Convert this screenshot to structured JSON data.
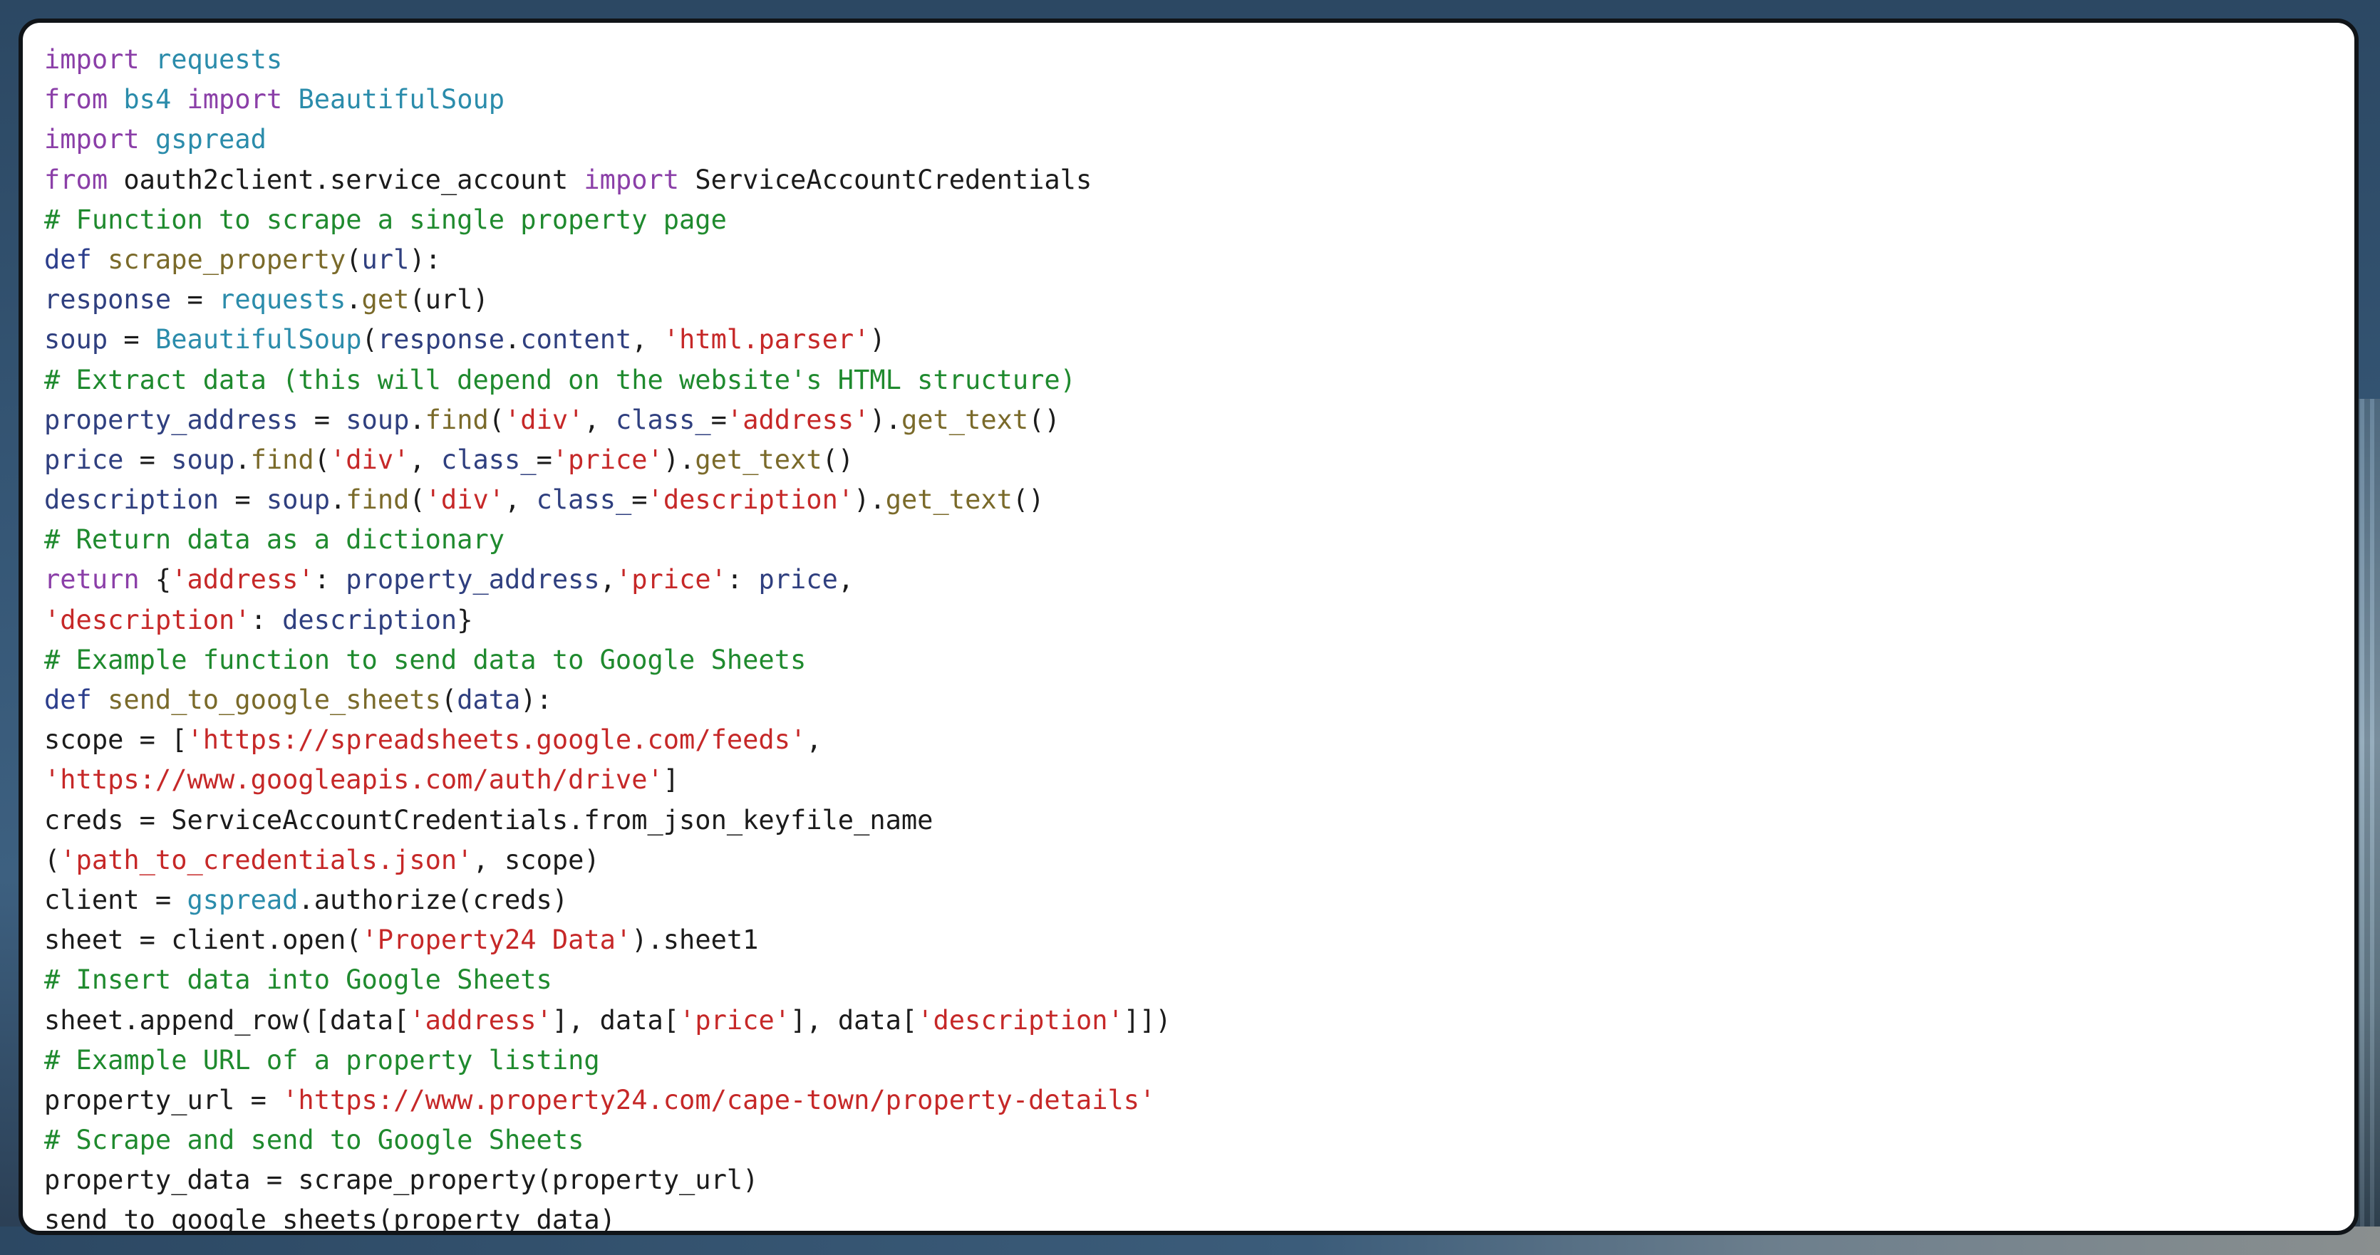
{
  "code": {
    "lines": [
      [
        {
          "t": "import",
          "c": "kw"
        },
        {
          "t": " ",
          "c": "pl"
        },
        {
          "t": "requests",
          "c": "mod"
        }
      ],
      [
        {
          "t": "from",
          "c": "kw"
        },
        {
          "t": " ",
          "c": "pl"
        },
        {
          "t": "bs4",
          "c": "mod"
        },
        {
          "t": " ",
          "c": "pl"
        },
        {
          "t": "import",
          "c": "kw"
        },
        {
          "t": " ",
          "c": "pl"
        },
        {
          "t": "BeautifulSoup",
          "c": "mod"
        }
      ],
      [
        {
          "t": "import",
          "c": "kw"
        },
        {
          "t": " ",
          "c": "pl"
        },
        {
          "t": "gspread",
          "c": "mod"
        }
      ],
      [
        {
          "t": "from",
          "c": "kw"
        },
        {
          "t": " oauth2client.service_account ",
          "c": "pl"
        },
        {
          "t": "import",
          "c": "kw"
        },
        {
          "t": " ServiceAccountCredentials",
          "c": "pl"
        }
      ],
      [
        {
          "t": "# Function to scrape a single property page",
          "c": "cmt"
        }
      ],
      [
        {
          "t": "def",
          "c": "def"
        },
        {
          "t": " ",
          "c": "pl"
        },
        {
          "t": "scrape_property",
          "c": "fn"
        },
        {
          "t": "(",
          "c": "pl"
        },
        {
          "t": "url",
          "c": "var"
        },
        {
          "t": "):",
          "c": "pl"
        }
      ],
      [
        {
          "t": "response",
          "c": "var"
        },
        {
          "t": " = ",
          "c": "pl"
        },
        {
          "t": "requests",
          "c": "mod"
        },
        {
          "t": ".",
          "c": "pl"
        },
        {
          "t": "get",
          "c": "fn"
        },
        {
          "t": "(url)",
          "c": "pl"
        }
      ],
      [
        {
          "t": "soup",
          "c": "var"
        },
        {
          "t": " = ",
          "c": "pl"
        },
        {
          "t": "BeautifulSoup",
          "c": "mod"
        },
        {
          "t": "(",
          "c": "pl"
        },
        {
          "t": "response",
          "c": "var"
        },
        {
          "t": ".",
          "c": "pl"
        },
        {
          "t": "content",
          "c": "var"
        },
        {
          "t": ", ",
          "c": "pl"
        },
        {
          "t": "'html.parser'",
          "c": "str"
        },
        {
          "t": ")",
          "c": "pl"
        }
      ],
      [
        {
          "t": "# Extract data (this will depend on the website's HTML structure)",
          "c": "cmt"
        }
      ],
      [
        {
          "t": "property_address",
          "c": "var"
        },
        {
          "t": " = ",
          "c": "pl"
        },
        {
          "t": "soup",
          "c": "var"
        },
        {
          "t": ".",
          "c": "pl"
        },
        {
          "t": "find",
          "c": "fn"
        },
        {
          "t": "(",
          "c": "pl"
        },
        {
          "t": "'div'",
          "c": "str"
        },
        {
          "t": ", ",
          "c": "pl"
        },
        {
          "t": "class_",
          "c": "var"
        },
        {
          "t": "=",
          "c": "pl"
        },
        {
          "t": "'address'",
          "c": "str"
        },
        {
          "t": ").",
          "c": "pl"
        },
        {
          "t": "get_text",
          "c": "fn"
        },
        {
          "t": "()",
          "c": "pl"
        }
      ],
      [
        {
          "t": "price",
          "c": "var"
        },
        {
          "t": " = ",
          "c": "pl"
        },
        {
          "t": "soup",
          "c": "var"
        },
        {
          "t": ".",
          "c": "pl"
        },
        {
          "t": "find",
          "c": "fn"
        },
        {
          "t": "(",
          "c": "pl"
        },
        {
          "t": "'div'",
          "c": "str"
        },
        {
          "t": ", ",
          "c": "pl"
        },
        {
          "t": "class_",
          "c": "var"
        },
        {
          "t": "=",
          "c": "pl"
        },
        {
          "t": "'price'",
          "c": "str"
        },
        {
          "t": ").",
          "c": "pl"
        },
        {
          "t": "get_text",
          "c": "fn"
        },
        {
          "t": "()",
          "c": "pl"
        }
      ],
      [
        {
          "t": "description",
          "c": "var"
        },
        {
          "t": " = ",
          "c": "pl"
        },
        {
          "t": "soup",
          "c": "var"
        },
        {
          "t": ".",
          "c": "pl"
        },
        {
          "t": "find",
          "c": "fn"
        },
        {
          "t": "(",
          "c": "pl"
        },
        {
          "t": "'div'",
          "c": "str"
        },
        {
          "t": ", ",
          "c": "pl"
        },
        {
          "t": "class_",
          "c": "var"
        },
        {
          "t": "=",
          "c": "pl"
        },
        {
          "t": "'description'",
          "c": "str"
        },
        {
          "t": ").",
          "c": "pl"
        },
        {
          "t": "get_text",
          "c": "fn"
        },
        {
          "t": "()",
          "c": "pl"
        }
      ],
      [
        {
          "t": "# Return data as a dictionary",
          "c": "cmt"
        }
      ],
      [
        {
          "t": "return",
          "c": "kw"
        },
        {
          "t": " {",
          "c": "pl"
        },
        {
          "t": "'address'",
          "c": "str"
        },
        {
          "t": ": ",
          "c": "pl"
        },
        {
          "t": "property_address",
          "c": "var"
        },
        {
          "t": ",",
          "c": "pl"
        },
        {
          "t": "'price'",
          "c": "str"
        },
        {
          "t": ": ",
          "c": "pl"
        },
        {
          "t": "price",
          "c": "var"
        },
        {
          "t": ",",
          "c": "pl"
        }
      ],
      [
        {
          "t": "'description'",
          "c": "str"
        },
        {
          "t": ": ",
          "c": "pl"
        },
        {
          "t": "description",
          "c": "var"
        },
        {
          "t": "}",
          "c": "pl"
        }
      ],
      [
        {
          "t": "# Example function to send data to Google Sheets",
          "c": "cmt"
        }
      ],
      [
        {
          "t": "def",
          "c": "def"
        },
        {
          "t": " ",
          "c": "pl"
        },
        {
          "t": "send_to_google_sheets",
          "c": "fn"
        },
        {
          "t": "(",
          "c": "pl"
        },
        {
          "t": "data",
          "c": "var"
        },
        {
          "t": "):",
          "c": "pl"
        }
      ],
      [
        {
          "t": "scope = [",
          "c": "pl"
        },
        {
          "t": "'https://spreadsheets.google.com/feeds'",
          "c": "str"
        },
        {
          "t": ",",
          "c": "pl"
        }
      ],
      [
        {
          "t": "'https://www.googleapis.com/auth/drive'",
          "c": "str"
        },
        {
          "t": "]",
          "c": "pl"
        }
      ],
      [
        {
          "t": "creds = ServiceAccountCredentials.from_json_keyfile_name",
          "c": "pl"
        }
      ],
      [
        {
          "t": "(",
          "c": "pl"
        },
        {
          "t": "'path_to_credentials.json'",
          "c": "str"
        },
        {
          "t": ", scope)",
          "c": "pl"
        }
      ],
      [
        {
          "t": "client = ",
          "c": "pl"
        },
        {
          "t": "gspread",
          "c": "mod"
        },
        {
          "t": ".authorize(creds)",
          "c": "pl"
        }
      ],
      [
        {
          "t": "sheet = client.open(",
          "c": "pl"
        },
        {
          "t": "'Property24 Data'",
          "c": "str"
        },
        {
          "t": ").sheet1",
          "c": "pl"
        }
      ],
      [
        {
          "t": "# Insert data into Google Sheets",
          "c": "cmt"
        }
      ],
      [
        {
          "t": "sheet.append_row([data[",
          "c": "pl"
        },
        {
          "t": "'address'",
          "c": "str"
        },
        {
          "t": "], data[",
          "c": "pl"
        },
        {
          "t": "'price'",
          "c": "str"
        },
        {
          "t": "], data[",
          "c": "pl"
        },
        {
          "t": "'description'",
          "c": "str"
        },
        {
          "t": "]])",
          "c": "pl"
        }
      ],
      [
        {
          "t": "# Example URL of a property listing",
          "c": "cmt"
        }
      ],
      [
        {
          "t": "property_url = ",
          "c": "pl"
        },
        {
          "t": "'https://www.property24.com/cape-town/property-details'",
          "c": "str"
        }
      ],
      [
        {
          "t": "# Scrape and send to Google Sheets",
          "c": "cmt"
        }
      ],
      [
        {
          "t": "property_data = scrape_property(property_url)",
          "c": "pl"
        }
      ],
      [
        {
          "t": "send_to_google_sheets(property_data)",
          "c": "pl"
        }
      ]
    ]
  },
  "colors": {
    "keyword": "#8b3fa8",
    "def_keyword": "#2c3e8c",
    "module": "#2b8cab",
    "function": "#7a6a2a",
    "variable": "#2f3f7f",
    "string": "#c62828",
    "comment": "#1f8a2e",
    "plain": "#1b1b1b",
    "window_bg": "#ffffff",
    "window_border": "#101418"
  }
}
